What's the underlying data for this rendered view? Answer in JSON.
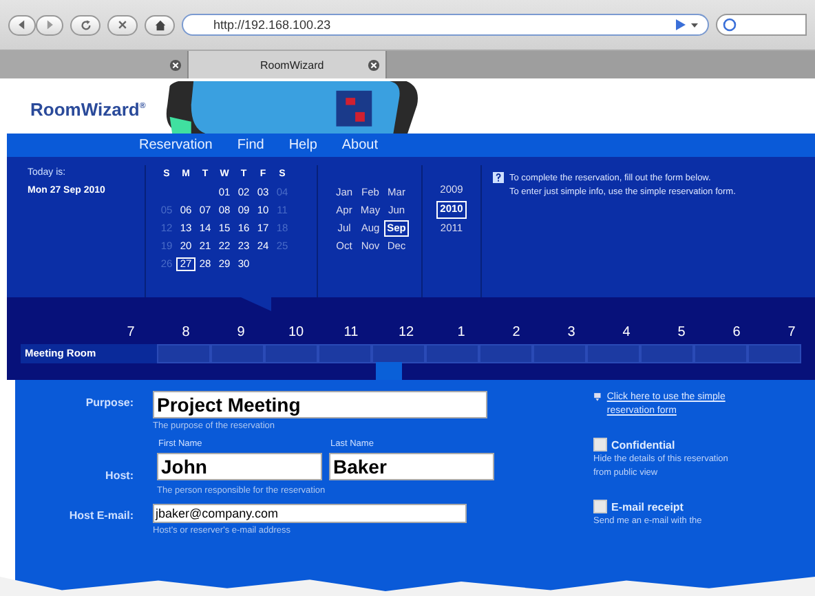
{
  "browser": {
    "url": "http://192.168.100.23",
    "tabs": [
      {
        "selected": false
      },
      {
        "label": "RoomWizard",
        "selected": true
      }
    ]
  },
  "logo": "RoomWizard",
  "logo_mark": "®",
  "nav": [
    "Reservation",
    "Find",
    "Help",
    "About"
  ],
  "today": {
    "label": "Today is:",
    "date": "Mon 27 Sep 2010"
  },
  "calendar": {
    "weekdays": [
      "S",
      "M",
      "T",
      "W",
      "T",
      "F",
      "S"
    ],
    "weeks": [
      [
        {
          "text": "01",
          "dim": false,
          "selected": false
        },
        {
          "text": "02",
          "dim": false,
          "selected": false
        },
        {
          "text": "03",
          "dim": false,
          "selected": false
        },
        {
          "text": "04",
          "dim": true,
          "selected": false
        }
      ],
      [
        {
          "text": "05",
          "dim": true,
          "selected": false
        },
        {
          "text": "06",
          "dim": false,
          "selected": false
        },
        {
          "text": "07",
          "dim": false,
          "selected": false
        },
        {
          "text": "08",
          "dim": false,
          "selected": false
        },
        {
          "text": "09",
          "dim": false,
          "selected": false
        },
        {
          "text": "10",
          "dim": false,
          "selected": false
        },
        {
          "text": "11",
          "dim": true,
          "selected": false
        }
      ],
      [
        {
          "text": "12",
          "dim": true,
          "selected": false
        },
        {
          "text": "13",
          "dim": false,
          "selected": false
        },
        {
          "text": "14",
          "dim": false,
          "selected": false
        },
        {
          "text": "15",
          "dim": false,
          "selected": false
        },
        {
          "text": "16",
          "dim": false,
          "selected": false
        },
        {
          "text": "17",
          "dim": false,
          "selected": false
        },
        {
          "text": "18",
          "dim": true,
          "selected": false
        }
      ],
      [
        {
          "text": "19",
          "dim": true,
          "selected": false
        },
        {
          "text": "20",
          "dim": false,
          "selected": false
        },
        {
          "text": "21",
          "dim": false,
          "selected": false
        },
        {
          "text": "22",
          "dim": false,
          "selected": false
        },
        {
          "text": "23",
          "dim": false,
          "selected": false
        },
        {
          "text": "24",
          "dim": false,
          "selected": false
        },
        {
          "text": "25",
          "dim": true,
          "selected": false
        }
      ],
      [
        {
          "text": "26",
          "dim": true,
          "selected": false
        },
        {
          "text": "27",
          "dim": false,
          "selected": true
        },
        {
          "text": "28",
          "dim": false,
          "selected": false
        },
        {
          "text": "29",
          "dim": false,
          "selected": false
        },
        {
          "text": "30",
          "dim": false,
          "selected": false
        }
      ]
    ],
    "months": [
      {
        "label": "Jan",
        "selected": false
      },
      {
        "label": "Feb",
        "selected": false
      },
      {
        "label": "Mar",
        "selected": false
      },
      {
        "label": "Apr",
        "selected": false
      },
      {
        "label": "May",
        "selected": false
      },
      {
        "label": "Jun",
        "selected": false
      },
      {
        "label": "Jul",
        "selected": false
      },
      {
        "label": "Aug",
        "selected": false
      },
      {
        "label": "Sep",
        "selected": true
      },
      {
        "label": "Oct",
        "selected": false
      },
      {
        "label": "Nov",
        "selected": false
      },
      {
        "label": "Dec",
        "selected": false
      }
    ],
    "years": [
      {
        "label": "2009",
        "selected": false
      },
      {
        "label": "2010",
        "selected": true
      },
      {
        "label": "2011",
        "selected": false
      }
    ]
  },
  "info": [
    "To complete the reservation, fill out the form below.",
    "To enter just simple info, use the simple reservation form."
  ],
  "timeline": {
    "hours": [
      "7",
      "8",
      "9",
      "10",
      "11",
      "12",
      "1",
      "2",
      "3",
      "4",
      "5",
      "6",
      "7"
    ],
    "room": "Meeting Room"
  },
  "form": {
    "purpose": {
      "label": "Purpose:",
      "value": "Project Meeting",
      "hint": "The purpose of the reservation"
    },
    "host": {
      "label": "Host:",
      "first_label": "First Name",
      "first": "John",
      "last_label": "Last Name",
      "last": "Baker",
      "hint": "The person responsible for the reservation"
    },
    "email": {
      "label": "Host E-mail:",
      "value": "jbaker@company.com",
      "hint": "Host's or reserver's e-mail address"
    }
  },
  "side": {
    "link": "Click here to use the simple reservation form",
    "options": [
      {
        "label": "Confidential",
        "checked": false,
        "desc": "Hide the details of this reservation from public view"
      },
      {
        "label": "E-mail receipt",
        "checked": false,
        "desc": "Send me an e-mail with the"
      }
    ]
  }
}
